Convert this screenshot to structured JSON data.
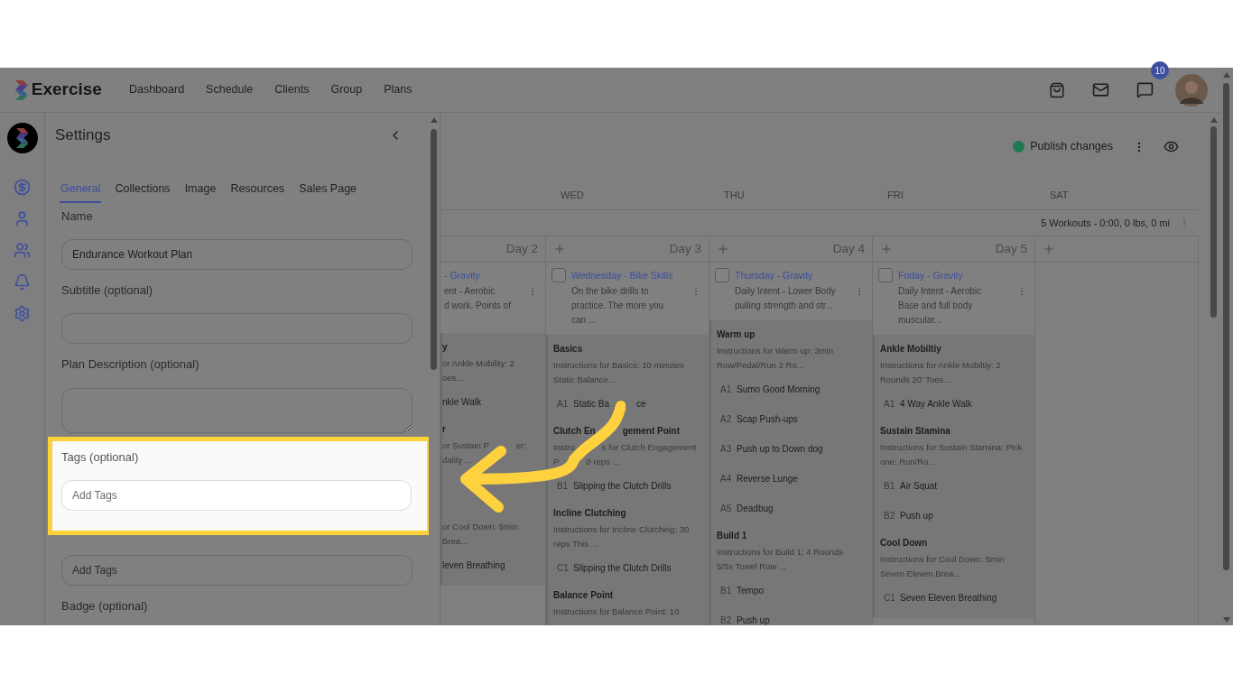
{
  "header": {
    "brand": "Exercise",
    "nav": [
      {
        "label": "Dashboard"
      },
      {
        "label": "Schedule"
      },
      {
        "label": "Clients"
      },
      {
        "label": "Group"
      },
      {
        "label": "Plans"
      }
    ],
    "badge": "10"
  },
  "rail": {
    "items": [
      {
        "kind": "dollar"
      },
      {
        "kind": "user"
      },
      {
        "kind": "users"
      },
      {
        "kind": "bell"
      },
      {
        "kind": "settings"
      }
    ]
  },
  "settings": {
    "title": "Settings",
    "tabs": [
      {
        "label": "General",
        "selected": true
      },
      {
        "label": "Collections",
        "selected": false
      },
      {
        "label": "Image",
        "selected": false
      },
      {
        "label": "Resources",
        "selected": false
      },
      {
        "label": "Sales Page",
        "selected": false
      }
    ],
    "fields": [
      {
        "kind": "input",
        "label": "Name",
        "value": "Endurance Workout Plan"
      },
      {
        "kind": "input",
        "label": "Subtitle (optional)"
      },
      {
        "kind": "textarea",
        "label": "Plan Description (optional)"
      },
      {
        "kind": "input",
        "label": "Tags (optional)",
        "placeholder": "Add Tags",
        "highlighted": true
      },
      {
        "kind": "input",
        "placeholder": "Add Tags"
      },
      {
        "kind": "label",
        "label": "Badge (optional)"
      }
    ]
  },
  "toolbar": {
    "publish": "Publish changes"
  },
  "calendar": {
    "weekdays": [
      "WED",
      "THU",
      "FRI",
      "SAT"
    ],
    "summary": "5 Workouts - 0:00, 0 lbs, 0 mi",
    "days": [
      {
        "label": "Day 2",
        "add_button": false,
        "partial": true,
        "workout": {
          "title": "- Gravity",
          "description": [
            "ent - Aerobic",
            "d work. Points of"
          ],
          "blocks": [
            {
              "kind": "section",
              "title": "y",
              "lines": [
                "or Ankle Mobility: 2",
                "oes..."
              ]
            },
            {
              "kind": "exercise",
              "name": "nkle Walk"
            },
            {
              "kind": "section",
              "title": "r",
              "lines": [
                [
                  "or Sustain P",
                  "er:"
                ],
                "dality ..."
              ]
            },
            {
              "kind": "section",
              "lines": [
                "or Cool Down: 5min",
                "Brea..."
              ]
            },
            {
              "kind": "exercise",
              "name": "leven Breathing"
            }
          ]
        }
      },
      {
        "label": "Day 3",
        "add_button": true,
        "workout": {
          "checked": false,
          "title": "Wednesday - Bike Skills",
          "description": [
            "On the bike drills to",
            "practice. The more you",
            "can ..."
          ],
          "blocks": [
            {
              "kind": "section",
              "title": "Basics",
              "lines": [
                "Instructions for Basics: 10 minutes",
                "Static Balance..."
              ]
            },
            {
              "kind": "exercise",
              "code": "A1",
              "name": [
                "Static Ba",
                "ce"
              ]
            },
            {
              "kind": "section",
              "title": [
                "Clutch En",
                "gement Point"
              ],
              "lines": [
                [
                  "Instru",
                  "s for Clutch Engagement"
                ],
                [
                  "P",
                  "0 reps ..."
                ]
              ]
            },
            {
              "kind": "exercise",
              "code": "B1",
              "name": "Slipping the Clutch Drills"
            },
            {
              "kind": "section",
              "title": "Incline Clutching",
              "lines": [
                "Instructions for Incline Clutching: 30",
                "reps This ..."
              ]
            },
            {
              "kind": "exercise",
              "code": "C1",
              "name": "Slipping the Clutch Drills"
            },
            {
              "kind": "section",
              "title": "Balance Point",
              "lines": [
                "Instructions for Balance Point: 10"
              ]
            }
          ]
        }
      },
      {
        "label": "Day 4",
        "add_button": true,
        "workout": {
          "checked": false,
          "title": "Thursday - Gravity",
          "description": [
            "Daily Intent - Lower Body",
            "pulling strength and str..."
          ],
          "blocks": [
            {
              "kind": "section",
              "title": "Warm up",
              "lines": [
                "Instructions for Warm up: 3min",
                "Row/Pedal/Run 2 Ro..."
              ]
            },
            {
              "kind": "exercise",
              "code": "A1",
              "name": "Sumo Good Morning"
            },
            {
              "kind": "exercise",
              "code": "A2",
              "name": "Scap Push-ups"
            },
            {
              "kind": "exercise",
              "code": "A3",
              "name": "Push up to Down dog"
            },
            {
              "kind": "exercise",
              "code": "A4",
              "name": "Reverse Lunge"
            },
            {
              "kind": "exercise",
              "code": "A5",
              "name": "Deadbug"
            },
            {
              "kind": "section",
              "title": "Build 1",
              "lines": [
                "Instructions for Build 1: 4 Rounds",
                "5/5x Towel Row ..."
              ]
            },
            {
              "kind": "exercise",
              "code": "B1",
              "name": "Tempo"
            },
            {
              "kind": "exercise",
              "code": "B2",
              "name": "Push up"
            }
          ]
        }
      },
      {
        "label": "Day 5",
        "add_button": true,
        "workout": {
          "checked": false,
          "title": "Friday - Gravity",
          "description": [
            "Daily Intent - Aerobic",
            "Base and full body",
            "muscular..."
          ],
          "blocks": [
            {
              "kind": "section",
              "title": "Ankle Mobiltiy",
              "lines": [
                "Instructions for Ankle Mobiltiy: 2",
                "Rounds 20' Toes..."
              ]
            },
            {
              "kind": "exercise",
              "code": "A1",
              "name": "4 Way Ankle Walk"
            },
            {
              "kind": "section",
              "title": "Sustain Stamina",
              "lines": [
                "Instructions for Sustain Stamina: Pick",
                "one: Run/Ro..."
              ]
            },
            {
              "kind": "exercise",
              "code": "B1",
              "name": "Air Squat"
            },
            {
              "kind": "exercise",
              "code": "B2",
              "name": "Push up"
            },
            {
              "kind": "section",
              "title": "Cool Down",
              "lines": [
                "Instructions for Cool Down: 5min",
                "Seven Eleven Brea..."
              ]
            },
            {
              "kind": "exercise",
              "code": "C1",
              "name": "Seven Eleven Breathing"
            }
          ]
        }
      },
      {
        "add_button": true
      }
    ]
  },
  "annotation": {
    "kind": "arrow"
  }
}
